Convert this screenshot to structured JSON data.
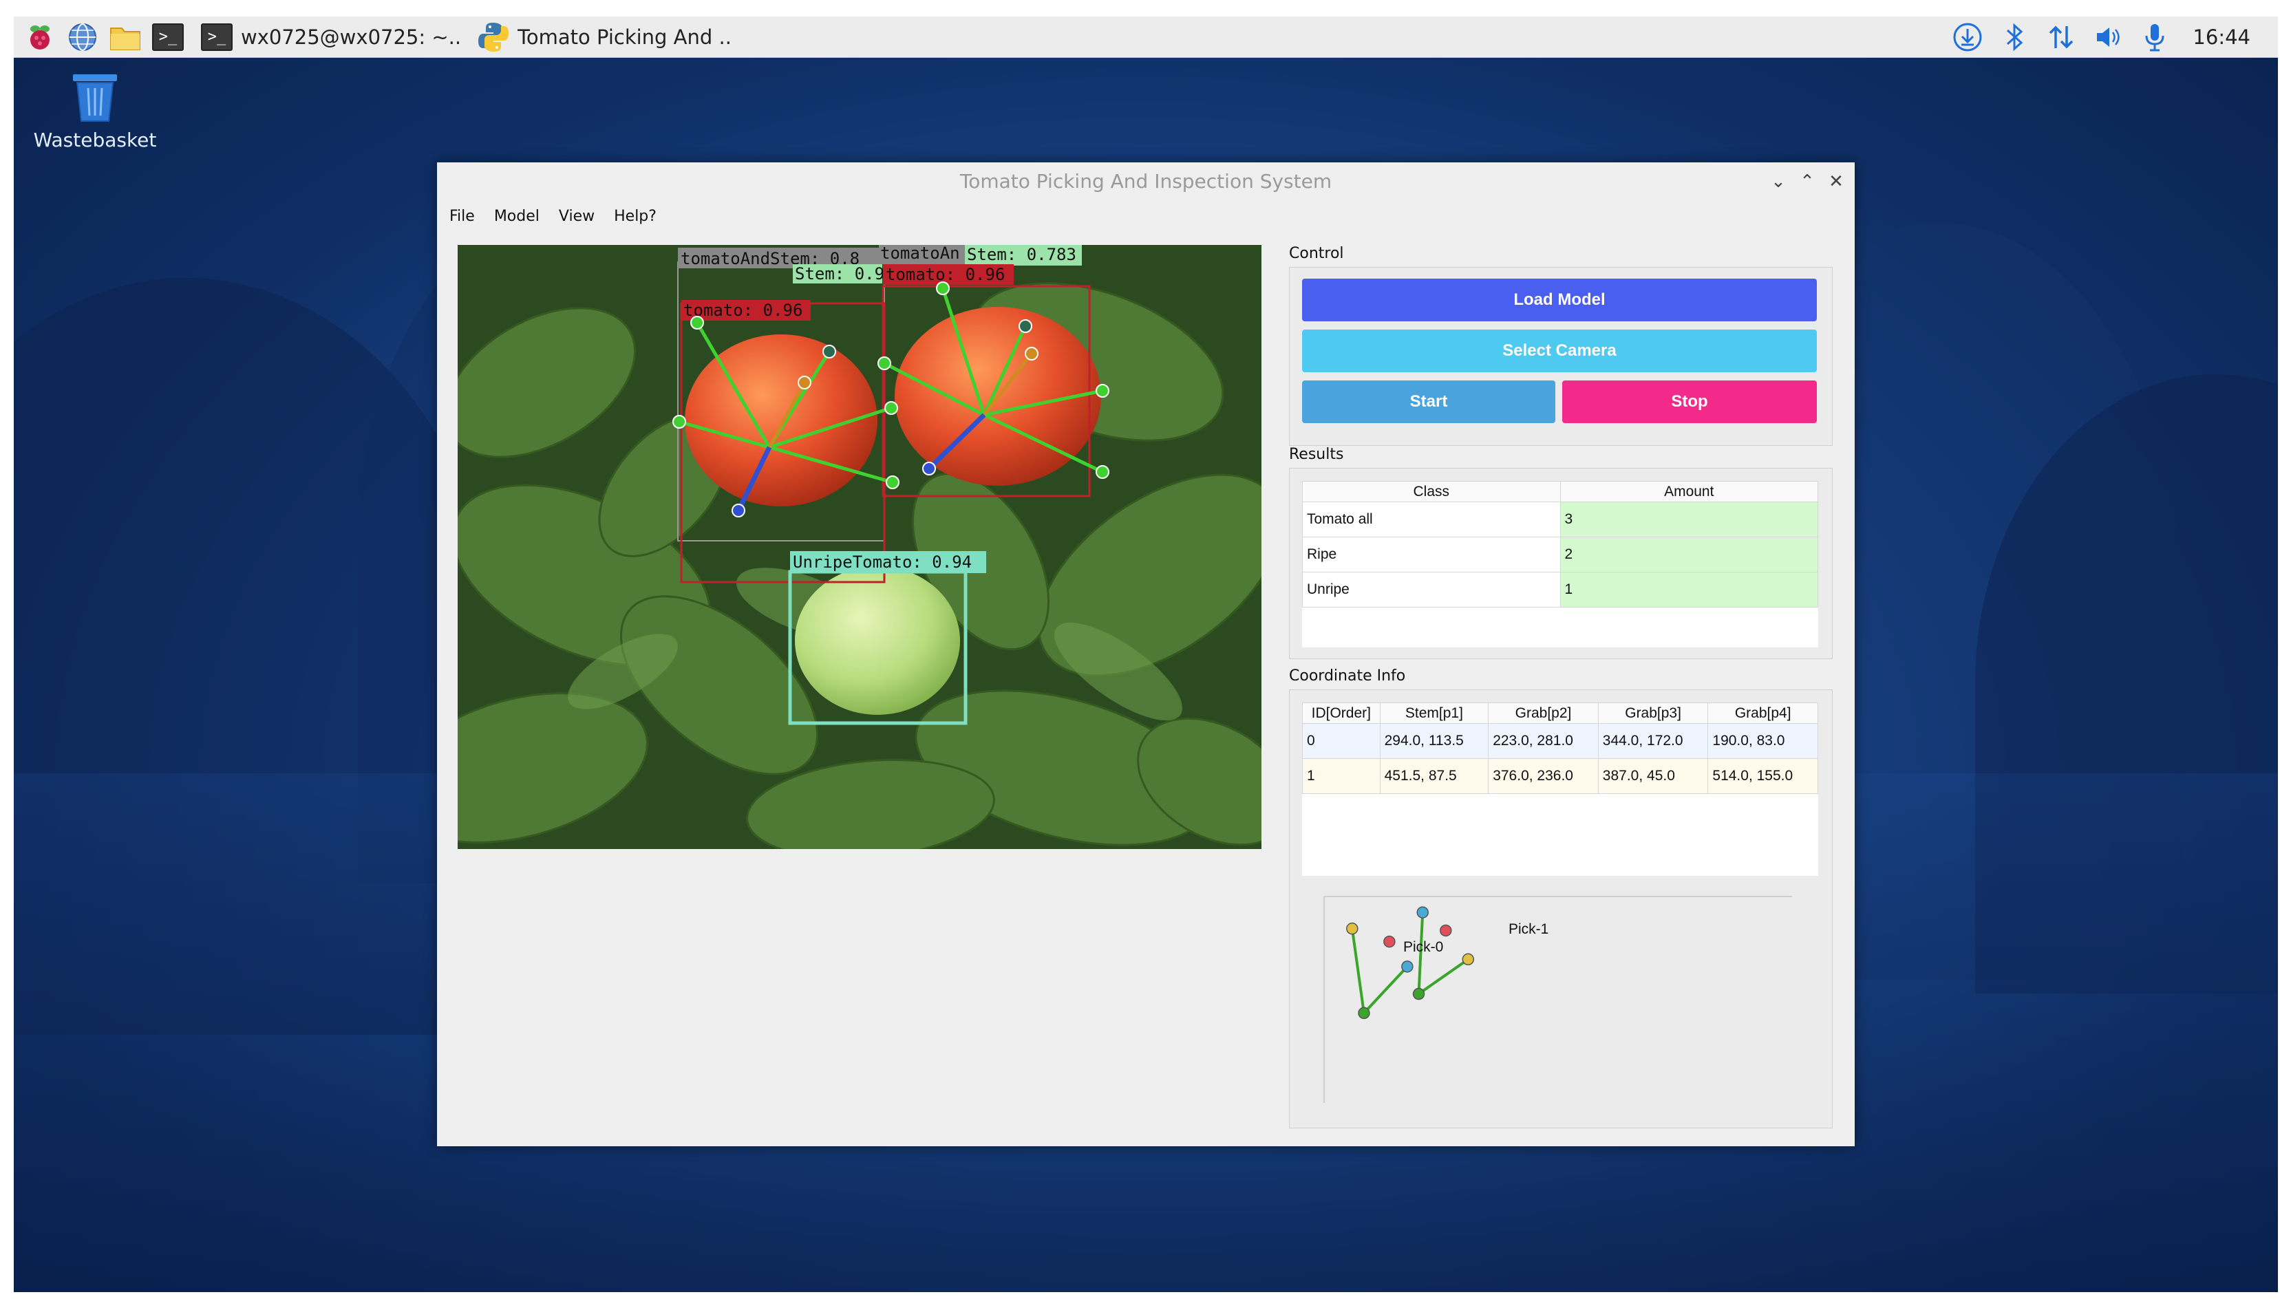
{
  "taskbar": {
    "terminal_task": "wx0725@wx0725: ~..",
    "app_task": "Tomato Picking And ..",
    "clock": "16:44"
  },
  "desktop": {
    "wastebasket_label": "Wastebasket"
  },
  "window": {
    "title": "Tomato Picking And Inspection System",
    "menu": [
      "File",
      "Model",
      "View",
      "Help?"
    ]
  },
  "detections": [
    {
      "label": "tomatoAndStem: 0.8",
      "color": "#888888"
    },
    {
      "label": "Stem: 0.9",
      "color": "#9be3a8"
    },
    {
      "label": "tomato: 0.96",
      "color": "#c0202a"
    },
    {
      "label": "tomatoAn",
      "color": "#888888"
    },
    {
      "label": "Stem: 0.783",
      "color": "#9be3a8"
    },
    {
      "label": "tomato: 0.96",
      "color": "#c0202a"
    },
    {
      "label": "UnripeTomato: 0.94",
      "color": "#7ee0c0"
    }
  ],
  "control": {
    "label": "Control",
    "load_model": "Load Model",
    "select_camera": "Select Camera",
    "start": "Start",
    "stop": "Stop",
    "colors": {
      "load": "#4a5ff0",
      "camera": "#4ec9f0",
      "start": "#4aa3dd",
      "stop": "#f22a8a"
    }
  },
  "results": {
    "label": "Results",
    "headers": [
      "Class",
      "Amount"
    ],
    "rows": [
      {
        "class": "Tomato all",
        "amount": "3"
      },
      {
        "class": "Ripe",
        "amount": "2"
      },
      {
        "class": "Unripe",
        "amount": "1"
      }
    ]
  },
  "coordinates": {
    "label": "Coordinate Info",
    "headers": [
      "ID[Order]",
      "Stem[p1]",
      "Grab[p2]",
      "Grab[p3]",
      "Grab[p4]"
    ],
    "rows": [
      [
        "0",
        "294.0, 113.5",
        "223.0, 281.0",
        "344.0, 172.0",
        "190.0, 83.0"
      ],
      [
        "1",
        "451.5, 87.5",
        "376.0, 236.0",
        "387.0, 45.0",
        "514.0, 155.0"
      ]
    ]
  },
  "plot": {
    "pick_labels": [
      "Pick-0",
      "Pick-1"
    ]
  }
}
